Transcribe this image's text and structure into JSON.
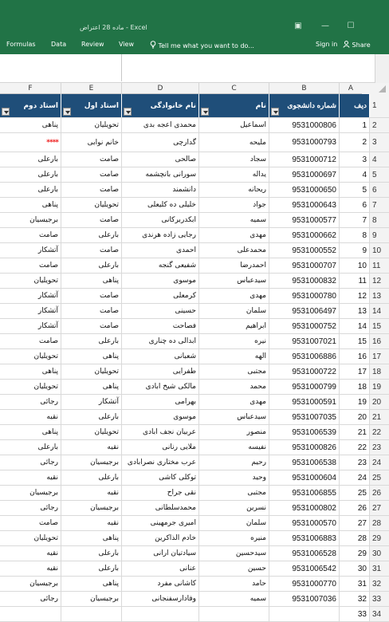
{
  "window": {
    "title": "ماده 28 اعتراض - Excel",
    "min_glyph": "—",
    "restore_glyph": "☐",
    "layout_glyph": "▣"
  },
  "ribbon": {
    "tabs": [
      "Formulas",
      "Data",
      "Review",
      "View"
    ],
    "tell_me": "Tell me what you want to do...",
    "sign_in": "Sign in",
    "share": "Share"
  },
  "columns": [
    "F",
    "E",
    "D",
    "C",
    "B",
    "A"
  ],
  "header": {
    "f": "استاد دوم",
    "e": "استاد اول",
    "d": "نام خانوادگی",
    "c": "نام",
    "b": "شماره دانشجوی",
    "a": "دیف",
    "row": "1"
  },
  "rows": [
    {
      "n": "2",
      "a": "1",
      "b": "9531000806",
      "c": "اسماعیل",
      "d": "محمدی اعجه بدی",
      "e": "تحویلیان",
      "f": "پناهی"
    },
    {
      "n": "3",
      "a": "2",
      "b": "9531000793",
      "c": "ملیحه",
      "d": "گدارچی",
      "e": "خانم نوابی",
      "f": "****"
    },
    {
      "n": "4",
      "a": "3",
      "b": "9531000712",
      "c": "سجاد",
      "d": "صالحی",
      "e": "صامت",
      "f": "بارعلی"
    },
    {
      "n": "5",
      "a": "4",
      "b": "9531000697",
      "c": "یداله",
      "d": "سورانی بانچشمه",
      "e": "صامت",
      "f": "بارعلی"
    },
    {
      "n": "6",
      "a": "5",
      "b": "9531000650",
      "c": "ریحانه",
      "d": "دانشمند",
      "e": "صامت",
      "f": "بارعلی"
    },
    {
      "n": "7",
      "a": "6",
      "b": "9531000643",
      "c": "جواد",
      "d": "خلیلی ده کلیعلی",
      "e": "تحویلیان",
      "f": "پناهی"
    },
    {
      "n": "8",
      "a": "7",
      "b": "9531000577",
      "c": "سمیه",
      "d": "ابکدربرکانی",
      "e": "صامت",
      "f": "برجیسیان"
    },
    {
      "n": "9",
      "a": "8",
      "b": "9531000662",
      "c": "مهدی",
      "d": "رجایی زاده هرندی",
      "e": "بارعلی",
      "f": "صامت"
    },
    {
      "n": "10",
      "a": "9",
      "b": "9531000552",
      "c": "محمدعلی",
      "d": "احمدی",
      "e": "صامت",
      "f": "آتشکار"
    },
    {
      "n": "11",
      "a": "10",
      "b": "9531000707",
      "c": "احمدرضا",
      "d": "شفیعی گنجه",
      "e": "بارعلی",
      "f": "صامت"
    },
    {
      "n": "12",
      "a": "11",
      "b": "9531000832",
      "c": "سیدعباس",
      "d": "موسوی",
      "e": "پناهی",
      "f": "تحویلیان"
    },
    {
      "n": "13",
      "a": "12",
      "b": "9531000780",
      "c": "مهدی",
      "d": "کرمعلی",
      "e": "صامت",
      "f": "آتشکار"
    },
    {
      "n": "14",
      "a": "13",
      "b": "9531006497",
      "c": "سلمان",
      "d": "حسینی",
      "e": "صامت",
      "f": "آتشکار"
    },
    {
      "n": "15",
      "a": "14",
      "b": "9531000752",
      "c": "ابراهیم",
      "d": "فصاحت",
      "e": "صامت",
      "f": "آتشکار"
    },
    {
      "n": "16",
      "a": "15",
      "b": "9531007021",
      "c": "نیره",
      "d": "ابدالی ده چناری",
      "e": "بارعلی",
      "f": "صامت"
    },
    {
      "n": "17",
      "a": "16",
      "b": "9531006886",
      "c": "الهه",
      "d": "شعبانی",
      "e": "پناهی",
      "f": "تحویلیان"
    },
    {
      "n": "18",
      "a": "17",
      "b": "9531000722",
      "c": "مجتبی",
      "d": "طفرایی",
      "e": "تحویلیان",
      "f": "پناهی"
    },
    {
      "n": "19",
      "a": "18",
      "b": "9531000799",
      "c": "محمد",
      "d": "مالکی شیخ ابادی",
      "e": "پناهی",
      "f": "تحویلیان"
    },
    {
      "n": "20",
      "a": "19",
      "b": "9531000591",
      "c": "مهدی",
      "d": "بهرامی",
      "e": "آتشکار",
      "f": "رجائی"
    },
    {
      "n": "21",
      "a": "20",
      "b": "9531007035",
      "c": "سیدعباس",
      "d": "موسوی",
      "e": "بارعلی",
      "f": "نقیه"
    },
    {
      "n": "22",
      "a": "21",
      "b": "9531006539",
      "c": "منصور",
      "d": "عربیان نجف ابادی",
      "e": "تحویلیان",
      "f": "پناهی"
    },
    {
      "n": "23",
      "a": "22",
      "b": "9531000826",
      "c": "نفیسه",
      "d": "ملایی رنانی",
      "e": "نقیه",
      "f": "بارعلی"
    },
    {
      "n": "24",
      "a": "23",
      "b": "9531006538",
      "c": "رحیم",
      "d": "عرب مختاری نصرابادی",
      "e": "برجیسیان",
      "f": "رجائی"
    },
    {
      "n": "25",
      "a": "24",
      "b": "9531000604",
      "c": "وحید",
      "d": "توکلی کاشی",
      "e": "بارعلی",
      "f": "نقیه"
    },
    {
      "n": "26",
      "a": "25",
      "b": "9531006855",
      "c": "مجتبی",
      "d": "نقی جراح",
      "e": "نقیه",
      "f": "برجیسیان"
    },
    {
      "n": "27",
      "a": "26",
      "b": "9531000802",
      "c": "نسرین",
      "d": "محمدسلطانی",
      "e": "برجیسیان",
      "f": "رجائی"
    },
    {
      "n": "28",
      "a": "27",
      "b": "9531000570",
      "c": "سلمان",
      "d": "امیری جرمهینی",
      "e": "نقیه",
      "f": "صامت"
    },
    {
      "n": "29",
      "a": "28",
      "b": "9531006883",
      "c": "منیره",
      "d": "خادم الذاکرین",
      "e": "پناهی",
      "f": "تحویلیان"
    },
    {
      "n": "30",
      "a": "29",
      "b": "9531006528",
      "c": "سیدحسین",
      "d": "سیادتیان ارانی",
      "e": "بارعلی",
      "f": "نقیه"
    },
    {
      "n": "31",
      "a": "30",
      "b": "9531006542",
      "c": "حسین",
      "d": "عنانی",
      "e": "بارعلی",
      "f": "نقیه"
    },
    {
      "n": "32",
      "a": "31",
      "b": "9531000770",
      "c": "حامد",
      "d": "کاشانی مفرد",
      "e": "پناهی",
      "f": "برجیسیان"
    },
    {
      "n": "33",
      "a": "32",
      "b": "9531007036",
      "c": "سمیه",
      "d": "وفادارسفنجانی",
      "e": "برجیسیان",
      "f": "رجائی"
    },
    {
      "n": "34",
      "a": "33",
      "b": "",
      "c": "",
      "d": "",
      "e": "",
      "f": ""
    }
  ]
}
